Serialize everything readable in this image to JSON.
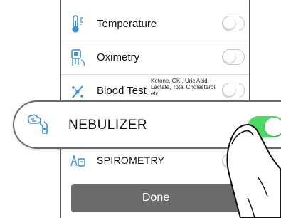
{
  "items": [
    {
      "label": "Temperature",
      "sub": "",
      "icon": "thermometer-icon",
      "enabled": false
    },
    {
      "label": "Oximetry",
      "sub": "",
      "icon": "oximeter-icon",
      "enabled": false
    },
    {
      "label": "Blood Test",
      "sub": "Ketone, GKI, Uric Acid, Lactate, Total Cholesterol, etc.",
      "icon": "blood-test-icon",
      "enabled": false
    }
  ],
  "highlight": {
    "label": "NEBULIZER",
    "icon": "nebulizer-icon",
    "enabled": true
  },
  "spirometry": {
    "label": "SPIROMETRY",
    "icon": "spirometry-icon"
  },
  "done_label": "Done",
  "colors": {
    "accent_green": "#4cd964",
    "icon_blue": "#3b8fd9",
    "button_gray": "#6b6b6b"
  }
}
